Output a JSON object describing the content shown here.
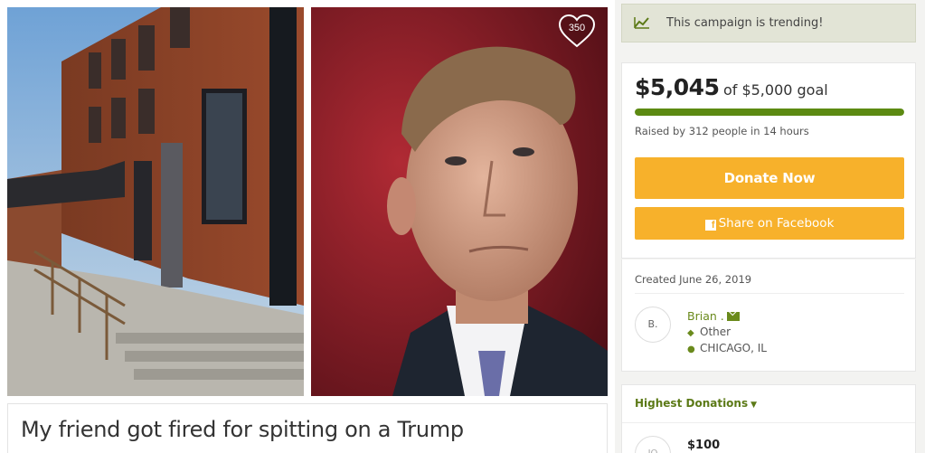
{
  "campaign": {
    "title": "My friend got fired for spitting on a Trump",
    "likes": "350"
  },
  "trending": {
    "icon": "trending-chart-icon",
    "text": "This campaign is trending!"
  },
  "funding": {
    "amount": "$5,045",
    "goal_text": "of $5,000 goal",
    "progress_fraction": 1.0,
    "raised_text": "Raised by 312 people in 14 hours",
    "donate_label": "Donate Now",
    "share_label": "Share on Facebook",
    "accent_color": "#f7b12b",
    "progress_color": "#5c8a12"
  },
  "organizer": {
    "created": "Created June 26, 2019",
    "avatar_initial": "B.",
    "name": "Brian .",
    "category": "Other",
    "location": "CHICAGO, IL"
  },
  "donations": {
    "heading": "Highest Donations",
    "top": [
      {
        "avatar": "JO",
        "amount": "$100"
      }
    ]
  }
}
